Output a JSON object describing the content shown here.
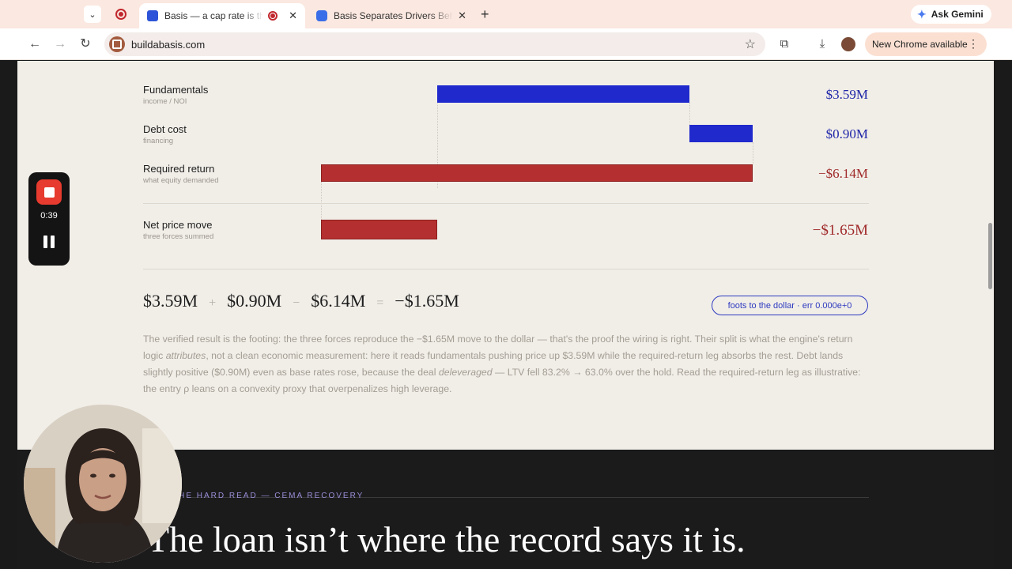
{
  "browser": {
    "tabs": [
      {
        "title": "Basis — a cap rate is three",
        "active": true
      },
      {
        "title": "Basis Separates Drivers Behind",
        "active": false
      }
    ],
    "ask_gemini": "Ask Gemini",
    "url": "buildabasis.com",
    "update_label": "New Chrome available"
  },
  "recorder": {
    "elapsed": "0:39"
  },
  "chart_data": {
    "type": "bar",
    "subtype": "waterfall",
    "unit": "$M",
    "rows": [
      {
        "label": "Fundamentals",
        "sublabel": "income / NOI",
        "value": 3.59,
        "value_label": "$3.59M",
        "color": "#2029cc"
      },
      {
        "label": "Debt cost",
        "sublabel": "financing",
        "value": 0.9,
        "value_label": "$0.90M",
        "color": "#2029cc"
      },
      {
        "label": "Required return",
        "sublabel": "what equity demanded",
        "value": -6.14,
        "value_label": "−$6.14M",
        "color": "#b42f2f"
      },
      {
        "label": "Net price move",
        "sublabel": "three forces summed",
        "value": -1.65,
        "value_label": "−$1.65M",
        "color": "#b42f2f",
        "total": true
      }
    ]
  },
  "equation": {
    "term1": "$3.59M",
    "op1": "+",
    "term2": "$0.90M",
    "op2": "−",
    "term3": "$6.14M",
    "op3": "=",
    "result": "−$1.65M",
    "badge": "foots to the dollar · err 0.000e+0"
  },
  "paragraph": {
    "p1": "The verified result is the footing: the three forces reproduce the −$1.65M move to the dollar — that's the proof the wiring is right. Their split is what the engine's return logic ",
    "em1": "attributes",
    "p2": ", not a clean economic measurement: here it reads fundamentals pushing price up $3.59M while the required-return leg absorbs the rest. Debt lands slightly positive ($0.90M) even as base rates rose, because the deal ",
    "em2": "deleveraged",
    "p3": " — LTV fell 83.2% → 63.0% over the hold. Read the required-return leg as illustrative: the entry ρ leans on a convexity proxy that overpenalizes high leverage."
  },
  "section": {
    "eyebrow": "THE HARD READ — CEMA RECOVERY",
    "headline": "The loan isn’t where the record says it is."
  }
}
